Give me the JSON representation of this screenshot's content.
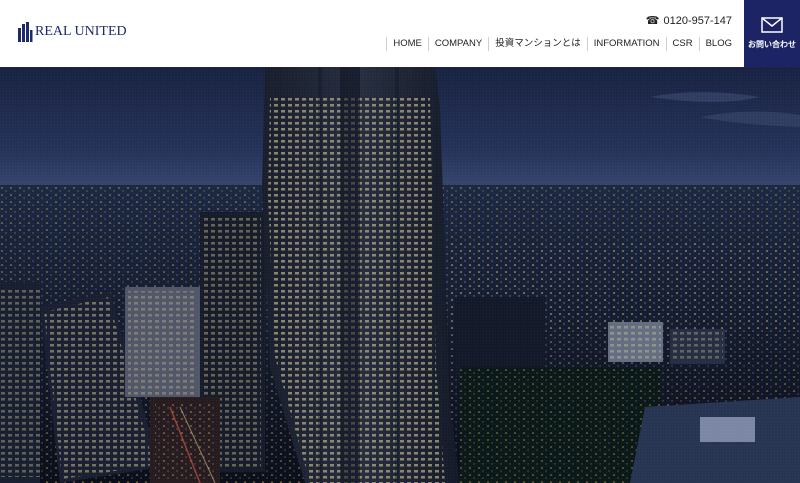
{
  "header": {
    "logo_text": "REAL UNITED",
    "phone_number": "0120-957-147",
    "contact_label": "お問い合わせ"
  },
  "nav": {
    "items": [
      {
        "label": "HOME"
      },
      {
        "label": "COMPANY"
      },
      {
        "label": "投資マンションとは"
      },
      {
        "label": "INFORMATION"
      },
      {
        "label": "CSR"
      },
      {
        "label": "BLOG"
      }
    ]
  },
  "icons": {
    "logo": "building-logo-icon",
    "phone": "phone-icon",
    "contact": "envelope-icon"
  },
  "colors": {
    "brand_navy": "#1d2466",
    "logo_blue": "#1f2a6b",
    "sky_night": "#1c2a55"
  }
}
